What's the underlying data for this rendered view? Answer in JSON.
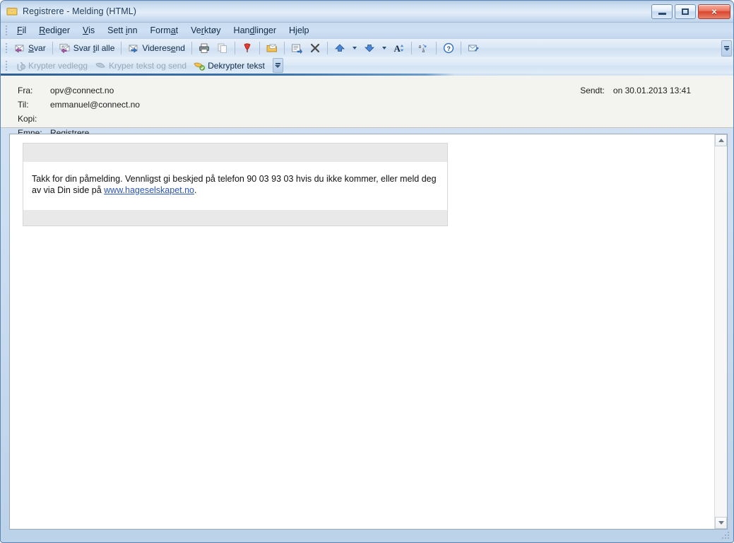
{
  "window": {
    "title": "Registrere - Melding (HTML)",
    "icon": "envelope-icon",
    "controls": {
      "minimize": "minimize-button",
      "maximize": "maximize-button",
      "close": "×"
    },
    "frame_color": "#5b84b1",
    "titlebar_color": "#cfe0f2",
    "close_button_color": "#d9452e"
  },
  "menu": {
    "items": [
      {
        "label": "Fil",
        "mnemonic": "F"
      },
      {
        "label": "Rediger",
        "mnemonic": "R"
      },
      {
        "label": "Vis",
        "mnemonic": "V"
      },
      {
        "label": "Sett inn",
        "mnemonic": "i"
      },
      {
        "label": "Format",
        "mnemonic": "a"
      },
      {
        "label": "Verktøy",
        "mnemonic": "r"
      },
      {
        "label": "Handlinger",
        "mnemonic": "d"
      },
      {
        "label": "Hjelp",
        "mnemonic": "j"
      }
    ]
  },
  "toolbar_main": {
    "buttons": [
      {
        "label": "Svar",
        "icon": "reply-icon",
        "disabled": false
      },
      {
        "label": "Svar til alle",
        "icon": "reply-all-icon",
        "disabled": false
      },
      {
        "label": "Videresend",
        "icon": "forward-icon",
        "disabled": false
      },
      {
        "label": "",
        "icon": "print-icon",
        "disabled": false
      },
      {
        "label": "",
        "icon": "copy-icon",
        "disabled": true
      },
      {
        "label": "",
        "icon": "follow-up-flag-icon",
        "disabled": false
      },
      {
        "label": "",
        "icon": "move-to-folder-icon",
        "disabled": false
      },
      {
        "label": "",
        "icon": "create-rule-icon",
        "disabled": false
      },
      {
        "label": "",
        "icon": "delete-x-icon",
        "disabled": false
      },
      {
        "label": "",
        "icon": "previous-item-up-arrow-icon",
        "disabled": false
      },
      {
        "label": "",
        "icon": "previous-dropdown-caret-icon",
        "disabled": false
      },
      {
        "label": "",
        "icon": "next-item-down-arrow-icon",
        "disabled": false
      },
      {
        "label": "",
        "icon": "next-dropdown-caret-icon",
        "disabled": false
      },
      {
        "label": "",
        "icon": "font-size-A-icon",
        "disabled": false
      },
      {
        "label": "",
        "icon": "translate-icon",
        "disabled": false
      },
      {
        "label": "",
        "icon": "help-question-icon",
        "disabled": false
      },
      {
        "label": "",
        "icon": "send-receive-icon",
        "disabled": false
      }
    ],
    "overflow": "toolbar-options-button"
  },
  "toolbar_encrypt": {
    "buttons": [
      {
        "label": "Krypter vedlegg",
        "icon": "attachment-encrypt-icon",
        "disabled": true
      },
      {
        "label": "Kryper tekst og send",
        "icon": "encrypt-text-send-icon",
        "disabled": true
      },
      {
        "label": "Dekrypter tekst",
        "icon": "decrypt-text-icon",
        "disabled": false
      }
    ],
    "overflow": "toolbar-options-button"
  },
  "message_header": {
    "fields": [
      {
        "label": "Fra:",
        "value": "opv@connect.no"
      },
      {
        "label": "Til:",
        "value": "emmanuel@connect.no"
      },
      {
        "label": "Kopi:",
        "value": ""
      },
      {
        "label": "Emne:",
        "value": "Registrere"
      }
    ],
    "sent_label": "Sendt:",
    "sent_value": "on 30.01.2013 13:41"
  },
  "message_body": {
    "text_before_link": "Takk for din påmelding. Vennligst gi beskjed på telefon 90 03 93 03 hvis du ikke kommer, eller meld deg av via Din side på ",
    "link_text": "www.hageselskapet.no",
    "text_after_link": ".",
    "link_color": "#2a56b8"
  },
  "scrollbar": {
    "up_arrow": "scroll-up-arrow-icon",
    "down_arrow": "scroll-down-arrow-icon"
  }
}
